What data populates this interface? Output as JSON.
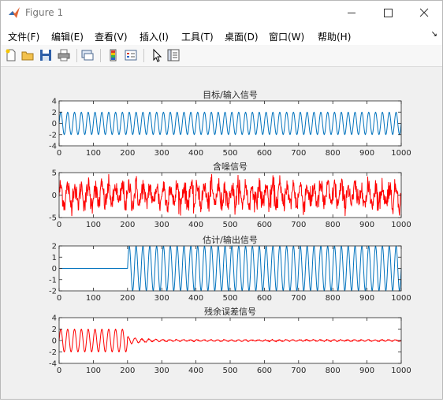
{
  "window": {
    "title": "Figure 1"
  },
  "menu": [
    "文件(F)",
    "编辑(E)",
    "查看(V)",
    "插入(I)",
    "工具(T)",
    "桌面(D)",
    "窗口(W)",
    "帮助(H)"
  ],
  "toolbar_icons": [
    "new-figure-icon",
    "open-file-icon",
    "save-icon",
    "print-icon",
    "link-plot-icon",
    "insert-colorbar-icon",
    "insert-legend-icon",
    "edit-plot-icon",
    "property-inspector-icon"
  ],
  "colors": {
    "blue": "#0072bd",
    "red": "#ff0000"
  },
  "chart_data": [
    {
      "type": "line",
      "title": "目标/输入信号",
      "xlim": [
        0,
        1000
      ],
      "ylim": [
        -4,
        4
      ],
      "xticks": [
        "0",
        "100",
        "200",
        "300",
        "400",
        "500",
        "600",
        "700",
        "800",
        "900",
        "1000"
      ],
      "yticks": [
        "4",
        "2",
        "0",
        "-2",
        "-4"
      ],
      "series": [
        {
          "color": "#0072bd",
          "kind": "sine",
          "amplitude": 2,
          "cycles": 50,
          "start": 0
        }
      ]
    },
    {
      "type": "line",
      "title": "含噪信号",
      "xlim": [
        0,
        1000
      ],
      "ylim": [
        -5,
        5
      ],
      "xticks": [
        "0",
        "100",
        "200",
        "300",
        "400",
        "500",
        "600",
        "700",
        "800",
        "900",
        "1000"
      ],
      "yticks": [
        "5",
        "0",
        "-5"
      ],
      "series": [
        {
          "color": "#ff0000",
          "kind": "noisy",
          "amplitude": 2,
          "cycles": 50,
          "noise_std": 1.2
        }
      ]
    },
    {
      "type": "line",
      "title": "估计/输出信号",
      "xlim": [
        0,
        1000
      ],
      "ylim": [
        -2,
        2
      ],
      "xticks": [
        "0",
        "100",
        "200",
        "300",
        "400",
        "500",
        "600",
        "700",
        "800",
        "900",
        "1000"
      ],
      "yticks": [
        "2",
        "1",
        "0",
        "-1",
        "-2"
      ],
      "series": [
        {
          "color": "#0072bd",
          "kind": "sine",
          "amplitude": 2,
          "cycles": 50,
          "start": 200
        }
      ]
    },
    {
      "type": "line",
      "title": "残余误差信号",
      "xlim": [
        0,
        1000
      ],
      "ylim": [
        -4,
        4
      ],
      "xticks": [
        "0",
        "100",
        "200",
        "300",
        "400",
        "500",
        "600",
        "700",
        "800",
        "900",
        "1000"
      ],
      "yticks": [
        "4",
        "2",
        "0",
        "-2",
        "-4"
      ],
      "series": [
        {
          "color": "#ff0000",
          "kind": "error",
          "amplitude": 2,
          "cycles": 50,
          "switch": 200
        }
      ]
    }
  ]
}
